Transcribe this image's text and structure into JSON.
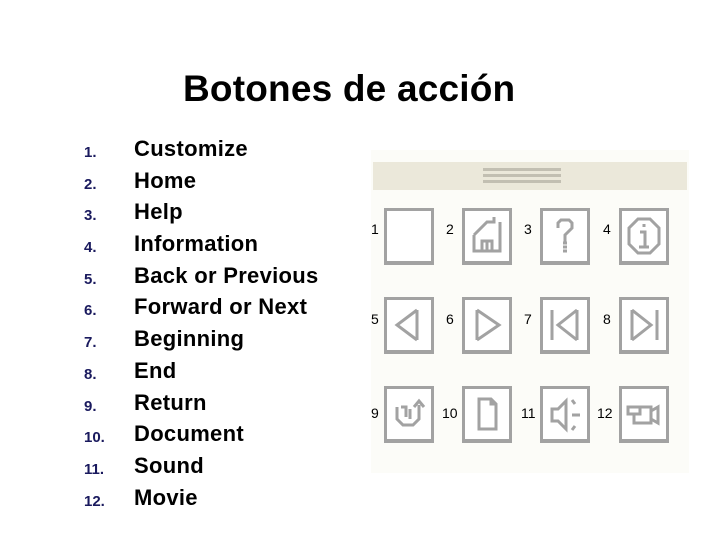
{
  "title": "Botones de acción",
  "list": [
    {
      "num": "1.",
      "label": "Customize"
    },
    {
      "num": "2.",
      "label": "Home"
    },
    {
      "num": "3.",
      "label": "Help"
    },
    {
      "num": "4.",
      "label": "Information"
    },
    {
      "num": "5.",
      "label": "Back or Previous"
    },
    {
      "num": "6.",
      "label": "Forward or Next"
    },
    {
      "num": "7.",
      "label": "Beginning"
    },
    {
      "num": "8.",
      "label": "End"
    },
    {
      "num": "9.",
      "label": "Return"
    },
    {
      "num": "10.",
      "label": "Document"
    },
    {
      "num": "11.",
      "label": "Sound"
    },
    {
      "num": "12.",
      "label": "Movie"
    }
  ],
  "buttons": [
    {
      "num": "1",
      "icon": "custom-blank-icon"
    },
    {
      "num": "2",
      "icon": "home-icon"
    },
    {
      "num": "3",
      "icon": "help-question-icon"
    },
    {
      "num": "4",
      "icon": "information-icon"
    },
    {
      "num": "5",
      "icon": "back-triangle-icon"
    },
    {
      "num": "6",
      "icon": "forward-triangle-icon"
    },
    {
      "num": "7",
      "icon": "beginning-icon"
    },
    {
      "num": "8",
      "icon": "end-icon"
    },
    {
      "num": "9",
      "icon": "return-icon"
    },
    {
      "num": "10",
      "icon": "document-icon"
    },
    {
      "num": "11",
      "icon": "sound-icon"
    },
    {
      "num": "12",
      "icon": "movie-icon"
    }
  ],
  "colors": {
    "number_color": "#1a1a5e",
    "icon_gray": "#a2a2a2",
    "panel_bar": "#ebe8da"
  }
}
